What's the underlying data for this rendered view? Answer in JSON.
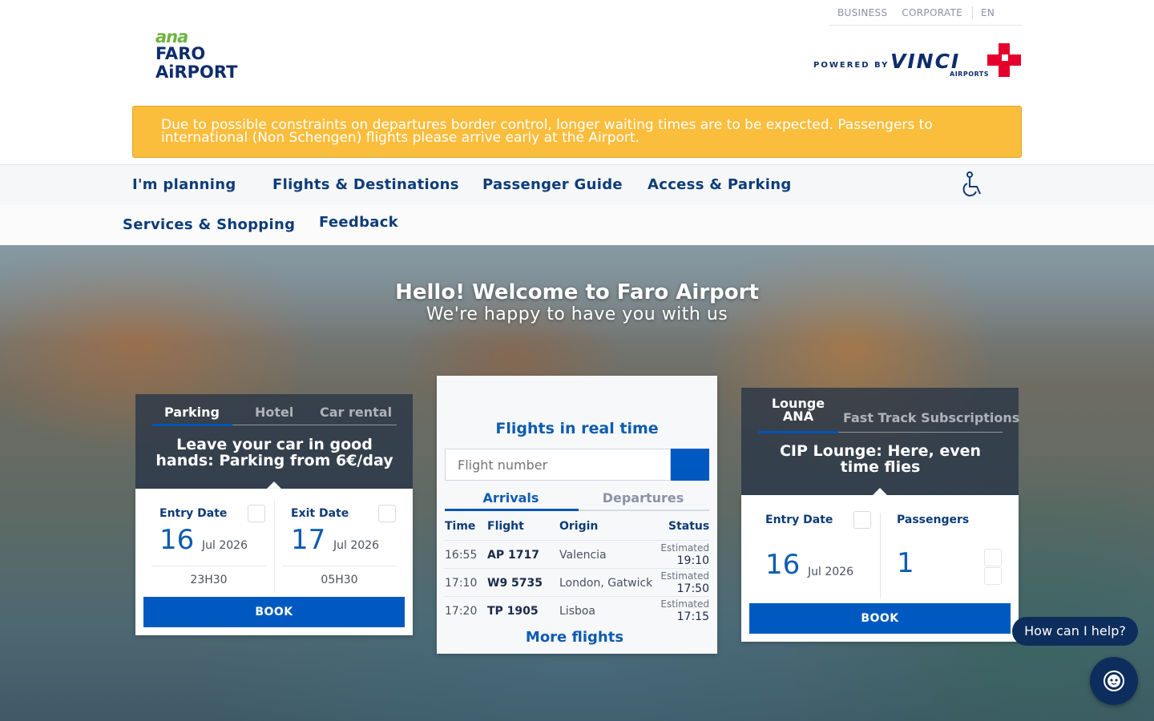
{
  "topbar": {
    "business": "BUSINESS",
    "corporate": "CORPORATE",
    "lang": "EN",
    "lang_chevron": ""
  },
  "logo": {
    "brand": "ana",
    "line1": "FARO",
    "line2": "AiRPORT"
  },
  "vinci": {
    "powered_by": "POWERED BY",
    "name": "VINCI",
    "sub": "AIRPORTS"
  },
  "alert": {
    "icon": "",
    "message": "Due to possible constraints on departures border control, longer waiting times are to be expected. Passengers to international (Non Schengen) flights please arrive early at the Airport.",
    "close": ""
  },
  "nav": {
    "items": [
      {
        "label": "I'm planning",
        "caret": ""
      },
      {
        "label": "Flights & Destinations"
      },
      {
        "label": "Passenger Guide"
      },
      {
        "label": "Access & Parking"
      },
      {
        "label": "Services & Shopping"
      },
      {
        "label": "Feedback"
      }
    ],
    "search_icon": ""
  },
  "hero": {
    "title": "Hello! Welcome to Faro Airport",
    "subtitle": "We're happy to have you with us"
  },
  "left_panel": {
    "tabs": [
      "Parking",
      "Hotel",
      "Car rental"
    ],
    "headline": "Leave your car in good hands: Parking from 6€/day",
    "entry": {
      "label": "Entry Date",
      "day": "16",
      "month": "Jul 2026",
      "time": "23H30",
      "cal_icon": ""
    },
    "exit": {
      "label": "Exit Date",
      "day": "17",
      "month": "Jul 2026",
      "time": "05H30",
      "cal_icon": ""
    },
    "book": "BOOK"
  },
  "flights": {
    "plane_icon": "",
    "title": "Flights in real time",
    "placeholder": "Flight number",
    "search_icon": "",
    "tabs": [
      "Arrivals",
      "Departures"
    ],
    "headers": {
      "time": "Time",
      "flight": "Flight",
      "origin": "Origin",
      "status": "Status"
    },
    "rows": [
      {
        "time": "16:55",
        "flight": "AP 1717",
        "origin": "Valencia",
        "status": "Estimated",
        "status_time": "19:10"
      },
      {
        "time": "17:10",
        "flight": "W9 5735",
        "origin": "London, Gatwick",
        "status": "Estimated",
        "status_time": "17:50"
      },
      {
        "time": "17:20",
        "flight": "TP 1905",
        "origin": "Lisboa",
        "status": "Estimated",
        "status_time": "17:15"
      }
    ],
    "more": "More flights",
    "more_arrow": ""
  },
  "right_panel": {
    "tabs": [
      "Lounge ANA",
      "Fast Track Subscriptions"
    ],
    "headline": "CIP Lounge: Here, even time flies",
    "entry": {
      "label": "Entry Date",
      "day": "16",
      "month": "Jul 2026",
      "cal_icon": ""
    },
    "passengers": {
      "label": "Passengers",
      "value": "1",
      "up": "",
      "down": ""
    },
    "book": "BOOK"
  },
  "chat": {
    "prompt": "How can I help?"
  }
}
